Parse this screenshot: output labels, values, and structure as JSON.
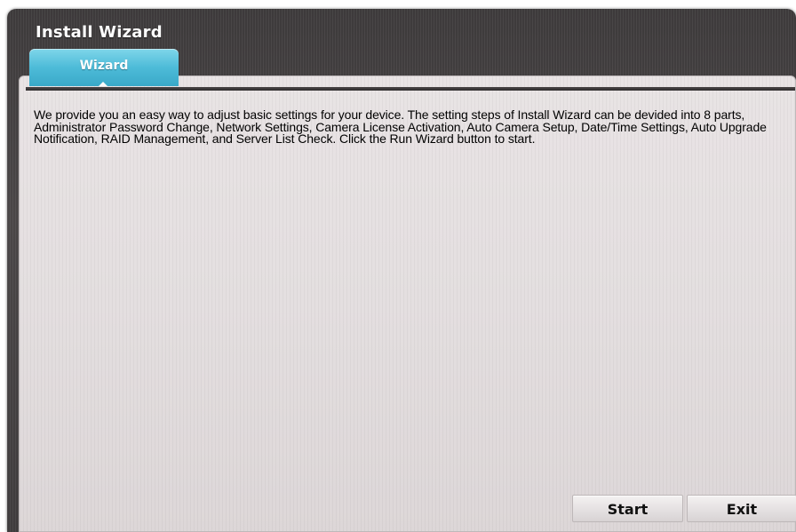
{
  "window": {
    "title": "Install Wizard"
  },
  "tabs": [
    {
      "label": "Wizard",
      "active": true
    }
  ],
  "content": {
    "description": "We provide you an easy way to adjust basic settings for your device. The setting steps of Install Wizard can be devided into 8 parts, Administrator Password Change,  Network Settings, Camera License Activation, Auto Camera Setup, Date/Time Settings, Auto Upgrade Notification, RAID Management, and Server List Check. Click the Run Wizard button to start."
  },
  "buttons": {
    "start_label": "Start",
    "exit_label": "Exit"
  },
  "colors": {
    "tab_accent": "#4dbbd8",
    "frame": "#3d3a3b",
    "panel": "#e6e1e2"
  }
}
